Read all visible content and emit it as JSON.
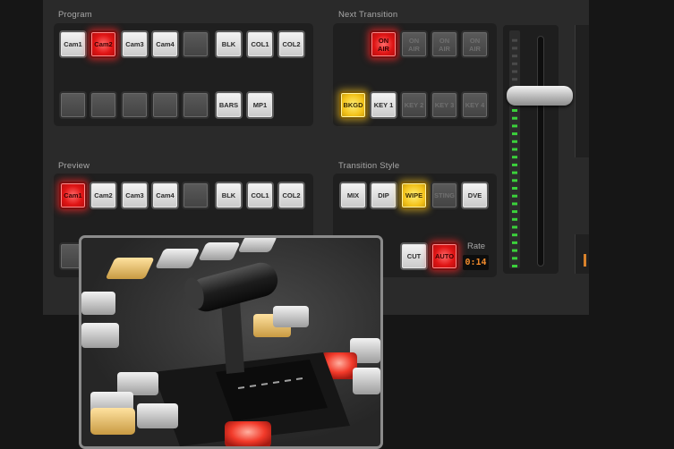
{
  "sections": {
    "program": "Program",
    "next_transition": "Next Transition",
    "preview": "Preview",
    "transition_style": "Transition Style",
    "rate_label": "Rate"
  },
  "program_row1": [
    {
      "label": "Cam1",
      "state": "white"
    },
    {
      "label": "Cam2",
      "state": "red"
    },
    {
      "label": "Cam3",
      "state": "white"
    },
    {
      "label": "Cam4",
      "state": "white"
    },
    {
      "label": "",
      "state": "dark"
    },
    {
      "label": "BLK",
      "state": "white"
    },
    {
      "label": "COL1",
      "state": "white"
    },
    {
      "label": "COL2",
      "state": "white"
    }
  ],
  "program_row2": [
    {
      "label": "",
      "state": "dark"
    },
    {
      "label": "",
      "state": "dark"
    },
    {
      "label": "",
      "state": "dark"
    },
    {
      "label": "",
      "state": "dark"
    },
    {
      "label": "",
      "state": "dark"
    },
    {
      "label": "BARS",
      "state": "white"
    },
    {
      "label": "MP1",
      "state": "white"
    }
  ],
  "preview_row": [
    {
      "label": "Cam1",
      "state": "red"
    },
    {
      "label": "Cam2",
      "state": "white"
    },
    {
      "label": "Cam3",
      "state": "white"
    },
    {
      "label": "Cam4",
      "state": "white"
    },
    {
      "label": "",
      "state": "dark"
    },
    {
      "label": "BLK",
      "state": "white"
    },
    {
      "label": "COL1",
      "state": "white"
    },
    {
      "label": "COL2",
      "state": "white"
    }
  ],
  "on_air_row": [
    {
      "label": "ON AIR",
      "state": "red"
    },
    {
      "label": "ON AIR",
      "state": "dark"
    },
    {
      "label": "ON AIR",
      "state": "dark"
    },
    {
      "label": "ON AIR",
      "state": "dark"
    }
  ],
  "key_row": [
    {
      "label": "BKGD",
      "state": "yellow"
    },
    {
      "label": "KEY 1",
      "state": "white"
    },
    {
      "label": "KEY 2",
      "state": "dark"
    },
    {
      "label": "KEY 3",
      "state": "dark"
    },
    {
      "label": "KEY 4",
      "state": "dark"
    }
  ],
  "style_row": [
    {
      "label": "MIX",
      "state": "white"
    },
    {
      "label": "DIP",
      "state": "white"
    },
    {
      "label": "WIPE",
      "state": "yellow"
    },
    {
      "label": "STING",
      "state": "dark"
    },
    {
      "label": "DVE",
      "state": "white"
    }
  ],
  "action_row": [
    {
      "label": "CUT",
      "state": "white"
    },
    {
      "label": "AUTO",
      "state": "red"
    }
  ],
  "rate_value": "0:14",
  "tbar_level": 0.72,
  "colors": {
    "panel": "#2a2a2a",
    "red": "#e01515",
    "yellow": "#f3c31b",
    "green_meter": "#3bd13b",
    "rate_orange": "#f08a2c"
  }
}
